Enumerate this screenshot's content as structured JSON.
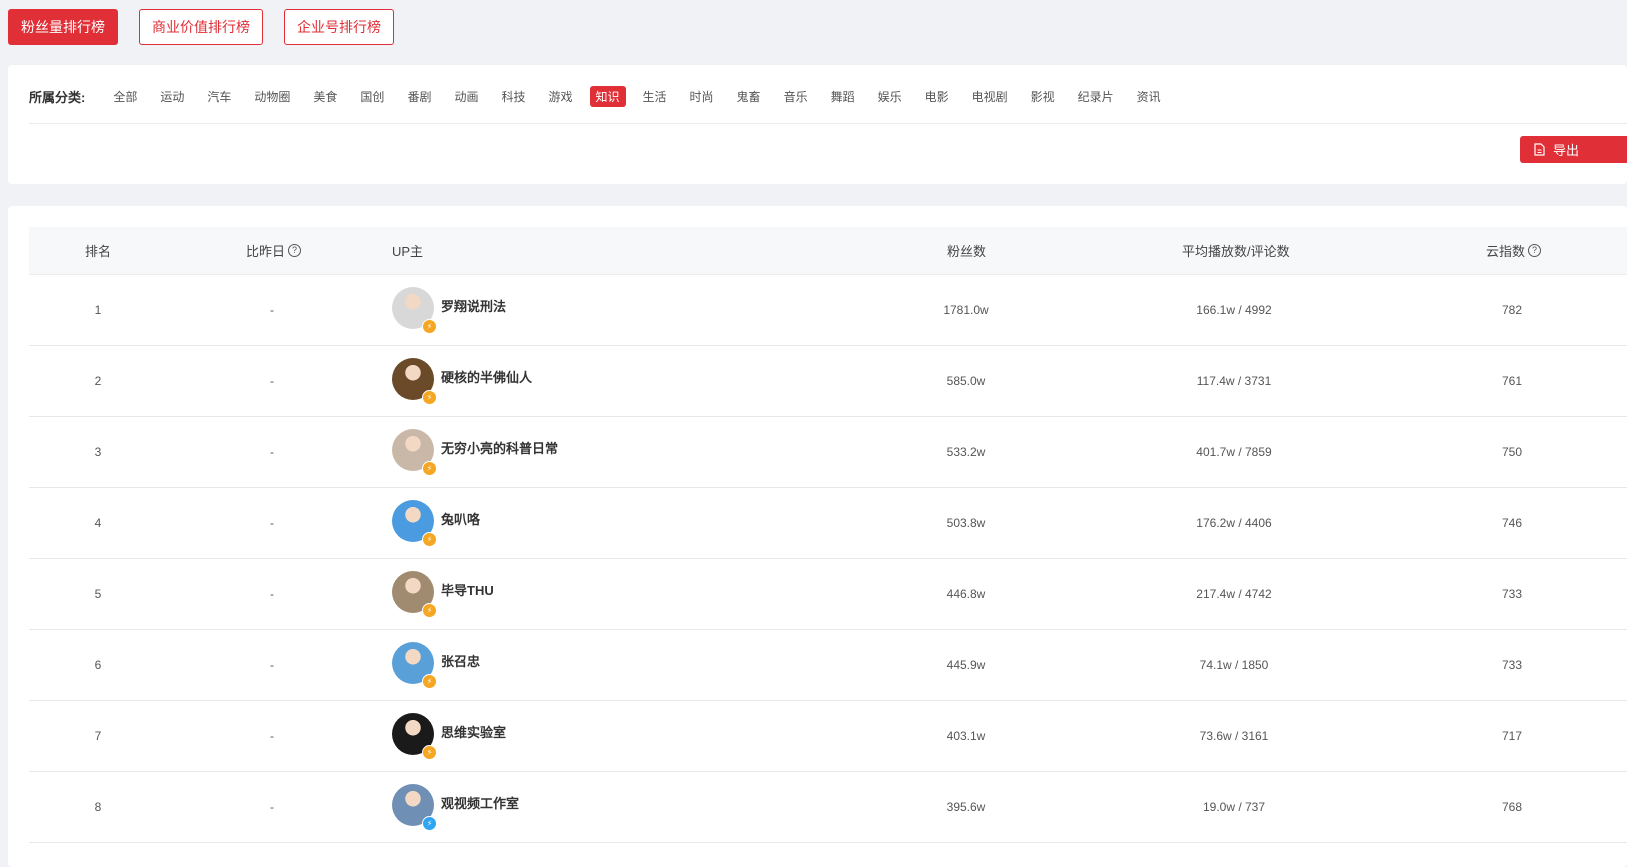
{
  "top_tabs": [
    {
      "label": "粉丝量排行榜",
      "active": true
    },
    {
      "label": "商业价值排行榜",
      "active": false
    },
    {
      "label": "企业号排行榜",
      "active": false
    }
  ],
  "filter": {
    "label": "所属分类:",
    "categories": [
      "全部",
      "运动",
      "汽车",
      "动物圈",
      "美食",
      "国创",
      "番剧",
      "动画",
      "科技",
      "游戏",
      "知识",
      "生活",
      "时尚",
      "鬼畜",
      "音乐",
      "舞蹈",
      "娱乐",
      "电影",
      "电视剧",
      "影视",
      "纪录片",
      "资讯"
    ],
    "active": "知识"
  },
  "export": {
    "label": "导出",
    "icon": "document-icon"
  },
  "table": {
    "headers": {
      "rank": "排名",
      "change": "比昨日",
      "up": "UP主",
      "fans": "粉丝数",
      "avg": "平均播放数/评论数",
      "index": "云指数"
    },
    "rows": [
      {
        "rank": "1",
        "change": "-",
        "name": "罗翔说刑法",
        "fans": "1781.0w",
        "avg": "166.1w / 4992",
        "index": "782",
        "badge": "orange",
        "avatar_color": "#d8d8d8"
      },
      {
        "rank": "2",
        "change": "-",
        "name": "硬核的半佛仙人",
        "fans": "585.0w",
        "avg": "117.4w / 3731",
        "index": "761",
        "badge": "orange",
        "avatar_color": "#6b4a2a"
      },
      {
        "rank": "3",
        "change": "-",
        "name": "无穷小亮的科普日常",
        "fans": "533.2w",
        "avg": "401.7w / 7859",
        "index": "750",
        "badge": "orange",
        "avatar_color": "#c9b8a8"
      },
      {
        "rank": "4",
        "change": "-",
        "name": "兔叭咯",
        "fans": "503.8w",
        "avg": "176.2w / 4406",
        "index": "746",
        "badge": "orange",
        "avatar_color": "#4a9be0"
      },
      {
        "rank": "5",
        "change": "-",
        "name": "毕导THU",
        "fans": "446.8w",
        "avg": "217.4w / 4742",
        "index": "733",
        "badge": "orange",
        "avatar_color": "#a08a70"
      },
      {
        "rank": "6",
        "change": "-",
        "name": "张召忠",
        "fans": "445.9w",
        "avg": "74.1w / 1850",
        "index": "733",
        "badge": "orange",
        "avatar_color": "#5aa0d8"
      },
      {
        "rank": "7",
        "change": "-",
        "name": "思维实验室",
        "fans": "403.1w",
        "avg": "73.6w / 3161",
        "index": "717",
        "badge": "orange",
        "avatar_color": "#1a1a1a"
      },
      {
        "rank": "8",
        "change": "-",
        "name": "观视频工作室",
        "fans": "395.6w",
        "avg": "19.0w / 737",
        "index": "768",
        "badge": "blue",
        "avatar_color": "#6f8fb5"
      }
    ]
  },
  "colors": {
    "accent": "#e02f37",
    "badge_orange": "#f5a623",
    "badge_blue": "#2fa4f2"
  }
}
